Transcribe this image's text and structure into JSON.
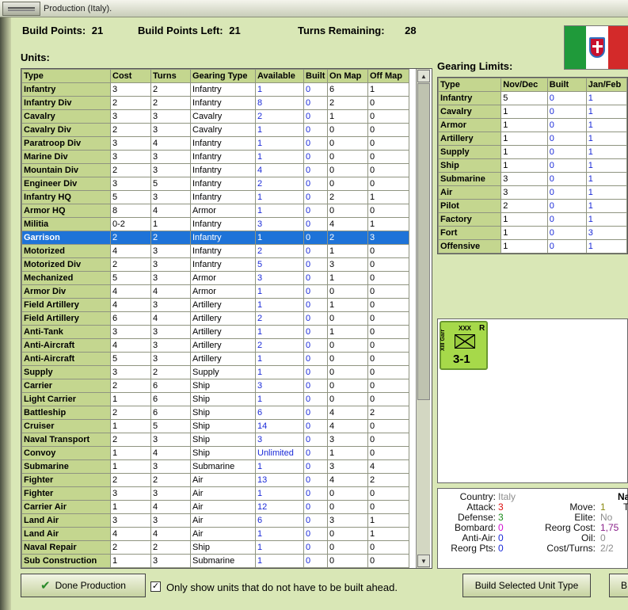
{
  "window": {
    "title": "Production (Italy)."
  },
  "stats": {
    "build_points_label": "Build Points:",
    "build_points": "21",
    "build_points_left_label": "Build Points Left:",
    "build_points_left": "21",
    "turns_remaining_label": "Turns Remaining:",
    "turns_remaining": "28"
  },
  "units": {
    "label": "Units:",
    "headers": [
      "Type",
      "Cost",
      "Turns",
      "Gearing Type",
      "Available",
      "Built",
      "On Map",
      "Off Map"
    ],
    "rows": [
      [
        "Infantry",
        "3",
        "2",
        "Infantry",
        "1",
        "0",
        "6",
        "1"
      ],
      [
        "Infantry Div",
        "2",
        "2",
        "Infantry",
        "8",
        "0",
        "2",
        "0"
      ],
      [
        "Cavalry",
        "3",
        "3",
        "Cavalry",
        "2",
        "0",
        "1",
        "0"
      ],
      [
        "Cavalry Div",
        "2",
        "3",
        "Cavalry",
        "1",
        "0",
        "0",
        "0"
      ],
      [
        "Paratroop Div",
        "3",
        "4",
        "Infantry",
        "1",
        "0",
        "0",
        "0"
      ],
      [
        "Marine Div",
        "3",
        "3",
        "Infantry",
        "1",
        "0",
        "0",
        "0"
      ],
      [
        "Mountain Div",
        "2",
        "3",
        "Infantry",
        "4",
        "0",
        "0",
        "0"
      ],
      [
        "Engineer Div",
        "3",
        "5",
        "Infantry",
        "2",
        "0",
        "0",
        "0"
      ],
      [
        "Infantry HQ",
        "5",
        "3",
        "Infantry",
        "1",
        "0",
        "2",
        "1"
      ],
      [
        "Armor HQ",
        "8",
        "4",
        "Armor",
        "1",
        "0",
        "0",
        "0"
      ],
      [
        "Militia",
        "0-2",
        "1",
        "Infantry",
        "3",
        "0",
        "4",
        "1"
      ],
      [
        "Garrison",
        "2",
        "2",
        "Infantry",
        "1",
        "0",
        "2",
        "3"
      ],
      [
        "Motorized",
        "4",
        "3",
        "Infantry",
        "2",
        "0",
        "1",
        "0"
      ],
      [
        "Motorized Div",
        "2",
        "3",
        "Infantry",
        "5",
        "0",
        "3",
        "0"
      ],
      [
        "Mechanized",
        "5",
        "3",
        "Armor",
        "3",
        "0",
        "1",
        "0"
      ],
      [
        "Armor Div",
        "4",
        "4",
        "Armor",
        "1",
        "0",
        "0",
        "0"
      ],
      [
        "Field Artillery",
        "4",
        "3",
        "Artillery",
        "1",
        "0",
        "1",
        "0"
      ],
      [
        "Field Artillery",
        "6",
        "4",
        "Artillery",
        "2",
        "0",
        "0",
        "0"
      ],
      [
        "Anti-Tank",
        "3",
        "3",
        "Artillery",
        "1",
        "0",
        "1",
        "0"
      ],
      [
        "Anti-Aircraft",
        "4",
        "3",
        "Artillery",
        "2",
        "0",
        "0",
        "0"
      ],
      [
        "Anti-Aircraft",
        "5",
        "3",
        "Artillery",
        "1",
        "0",
        "0",
        "0"
      ],
      [
        "Supply",
        "3",
        "2",
        "Supply",
        "1",
        "0",
        "0",
        "0"
      ],
      [
        "Carrier",
        "2",
        "6",
        "Ship",
        "3",
        "0",
        "0",
        "0"
      ],
      [
        "Light Carrier",
        "1",
        "6",
        "Ship",
        "1",
        "0",
        "0",
        "0"
      ],
      [
        "Battleship",
        "2",
        "6",
        "Ship",
        "6",
        "0",
        "4",
        "2"
      ],
      [
        "Cruiser",
        "1",
        "5",
        "Ship",
        "14",
        "0",
        "4",
        "0"
      ],
      [
        "Naval Transport",
        "2",
        "3",
        "Ship",
        "3",
        "0",
        "3",
        "0"
      ],
      [
        "Convoy",
        "1",
        "4",
        "Ship",
        "Unlimited",
        "0",
        "1",
        "0"
      ],
      [
        "Submarine",
        "1",
        "3",
        "Submarine",
        "1",
        "0",
        "3",
        "4"
      ],
      [
        "Fighter",
        "2",
        "2",
        "Air",
        "13",
        "0",
        "4",
        "2"
      ],
      [
        "Fighter",
        "3",
        "3",
        "Air",
        "1",
        "0",
        "0",
        "0"
      ],
      [
        "Carrier Air",
        "1",
        "4",
        "Air",
        "12",
        "0",
        "0",
        "0"
      ],
      [
        "Land Air",
        "3",
        "3",
        "Air",
        "6",
        "0",
        "3",
        "1"
      ],
      [
        "Land Air",
        "4",
        "4",
        "Air",
        "1",
        "0",
        "0",
        "1"
      ],
      [
        "Naval Repair",
        "2",
        "2",
        "Ship",
        "1",
        "0",
        "0",
        "0"
      ],
      [
        "Sub Construction",
        "1",
        "3",
        "Submarine",
        "1",
        "0",
        "0",
        "0"
      ]
    ],
    "selected_index": 11
  },
  "gearing": {
    "label": "Gearing Limits:",
    "headers": [
      "Type",
      "Nov/Dec",
      "Built",
      "Jan/Feb"
    ],
    "rows": [
      [
        "Infantry",
        "5",
        "0",
        "1"
      ],
      [
        "Cavalry",
        "1",
        "0",
        "1"
      ],
      [
        "Armor",
        "1",
        "0",
        "1"
      ],
      [
        "Artillery",
        "1",
        "0",
        "1"
      ],
      [
        "Supply",
        "1",
        "0",
        "1"
      ],
      [
        "Ship",
        "1",
        "0",
        "1"
      ],
      [
        "Submarine",
        "3",
        "0",
        "1"
      ],
      [
        "Air",
        "3",
        "0",
        "1"
      ],
      [
        "Pilot",
        "2",
        "0",
        "1"
      ],
      [
        "Factory",
        "1",
        "0",
        "1"
      ],
      [
        "Fort",
        "1",
        "0",
        "3"
      ],
      [
        "Offensive",
        "1",
        "0",
        "1"
      ]
    ]
  },
  "counter": {
    "size": "XXX",
    "name": "XIII Garr",
    "strength": "3-1",
    "flag": "R"
  },
  "info": {
    "country_label": "Country:",
    "country": "Italy",
    "attack_label": "Attack:",
    "attack": "3",
    "defense_label": "Defense:",
    "defense": "3",
    "bombard_label": "Bombard:",
    "bombard": "0",
    "anti_air_label": "Anti-Air:",
    "anti_air": "0",
    "reorg_pts_label": "Reorg Pts:",
    "reorg_pts": "0",
    "move_label": "Move:",
    "move": "1",
    "elite_label": "Elite:",
    "elite": "No",
    "reorg_cost_label": "Reorg Cost:",
    "reorg_cost": "1,75",
    "oil_label": "Oil:",
    "oil": "0",
    "cost_turns_label": "Cost/Turns:",
    "cost_turns": "2/2",
    "cut_na": "Na",
    "cut_t": "T"
  },
  "footer": {
    "done_label": "Done Production",
    "checkbox_label": "Only show units that do not have to be built ahead.",
    "build_label": "Build Selected Unit Type",
    "cut_button_label": "B"
  }
}
